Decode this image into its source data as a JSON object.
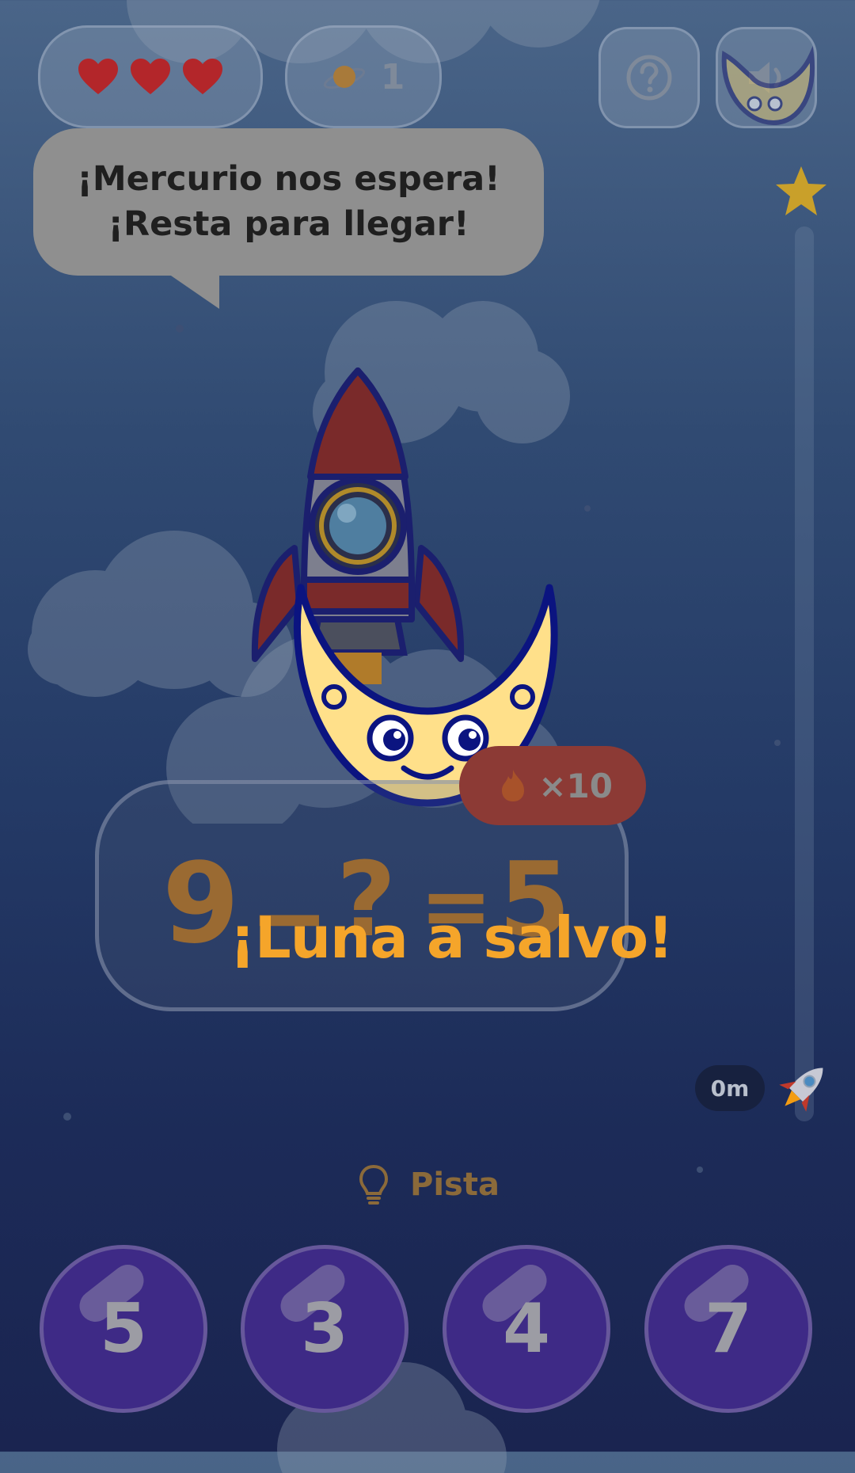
{
  "hud": {
    "lives": 3,
    "planets_count": "1",
    "help_icon": "question-circle-icon",
    "sound_icon": "speaker-icon"
  },
  "bubble": {
    "line1": "¡Mercurio nos espera!",
    "line2": "¡Resta para llegar!"
  },
  "progress": {
    "meters": "0m",
    "goal_icon": "star-icon",
    "marker_icon": "rocket-icon"
  },
  "equation": {
    "a": "9",
    "op": "−",
    "unknown": "?",
    "eq": "=",
    "result": "5"
  },
  "streak": {
    "label": "×10",
    "icon": "fire-icon"
  },
  "overlay": {
    "message": "¡Luna a salvo!"
  },
  "hint": {
    "label": "Pista",
    "icon": "lightbulb-icon"
  },
  "answers": [
    "5",
    "3",
    "4",
    "7"
  ],
  "colors": {
    "answer_bg": "#3e2a86",
    "accent_orange": "#f5a52a",
    "heart": "#b3262a",
    "moon": "#ffe08a"
  }
}
